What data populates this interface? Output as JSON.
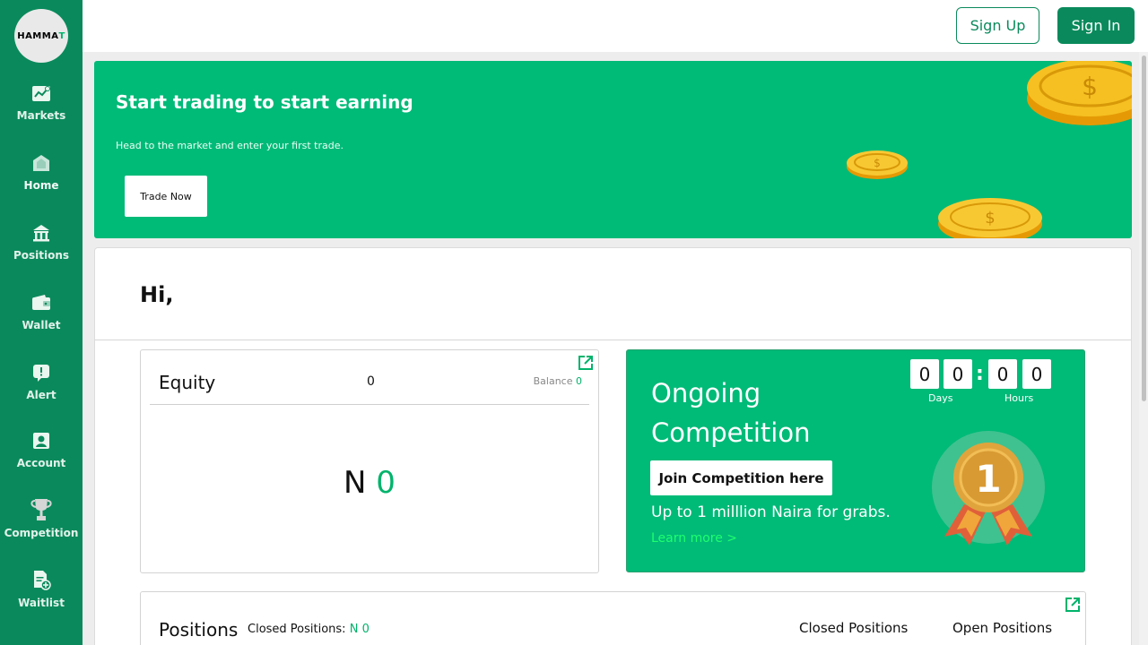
{
  "brand": {
    "logo_text": "HAMMA",
    "logo_accent": "T",
    "primary_color": "#0a8a5c",
    "accent_color": "#00ba78"
  },
  "sidebar": {
    "items": [
      {
        "label": "Markets",
        "icon": "chart-icon"
      },
      {
        "label": "Home",
        "icon": "home-icon"
      },
      {
        "label": "Positions",
        "icon": "bank-icon"
      },
      {
        "label": "Wallet",
        "icon": "wallet-icon"
      },
      {
        "label": "Alert",
        "icon": "alert-icon"
      },
      {
        "label": "Account",
        "icon": "account-icon"
      },
      {
        "label": "Competition",
        "icon": "trophy-icon"
      },
      {
        "label": "Waitlist",
        "icon": "waitlist-icon"
      }
    ],
    "active": "Home"
  },
  "header": {
    "signup_label": "Sign Up",
    "signin_label": "Sign In"
  },
  "banner": {
    "title": "Start trading to start earning",
    "subtitle": "Head to the market and enter your first trade.",
    "button_label": "Trade Now"
  },
  "greeting": "Hi,",
  "equity": {
    "label": "Equity",
    "value": "0",
    "balance_label": "Balance",
    "balance_value": "0",
    "big_currency": "N",
    "big_value": "0"
  },
  "competition": {
    "title": "Ongoing Competition",
    "join_label": "Join Competition here",
    "prize_text": "Up to 1 milllion Naira for grabs.",
    "learn_more": "Learn more >",
    "countdown": {
      "digits": [
        "0",
        "0",
        "0",
        "0"
      ],
      "separator": ":",
      "days_label": "Days",
      "hours_label": "Hours"
    },
    "medal_number": "1"
  },
  "positions": {
    "title": "Positions",
    "closed_label": "Closed Positions:",
    "closed_value": "N 0",
    "tab_closed": "Closed Positions",
    "tab_open": "Open Positions"
  }
}
